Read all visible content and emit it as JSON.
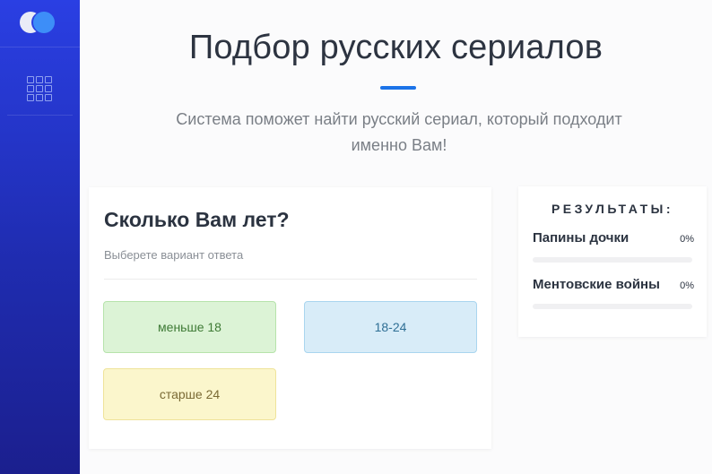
{
  "header": {
    "title": "Подбор русских сериалов",
    "subtitle_line1": "Система поможет найти русский сериал, который подходит",
    "subtitle_line2": "именно Вам!"
  },
  "question": {
    "title": "Сколько Вам лет?",
    "hint": "Выберете вариант ответа",
    "answers": [
      {
        "label": "меньше 18",
        "color": "#dcf3d6"
      },
      {
        "label": "18-24",
        "color": "#d8ecf8"
      },
      {
        "label": "старше 24",
        "color": "#fbf6cc"
      }
    ]
  },
  "results": {
    "title": "РЕЗУЛЬТАТЫ:",
    "items": [
      {
        "name": "Папины дочки",
        "percent_label": "0%",
        "percent": 0
      },
      {
        "name": "Ментовские войны",
        "percent_label": "0%",
        "percent": 0
      }
    ]
  },
  "sidebar": {
    "icons": [
      "logo-icon",
      "grid-icon"
    ]
  },
  "colors": {
    "accent": "#1b73e8",
    "sidebar_top": "#2a3fe3",
    "sidebar_bottom": "#1b1f8e"
  }
}
